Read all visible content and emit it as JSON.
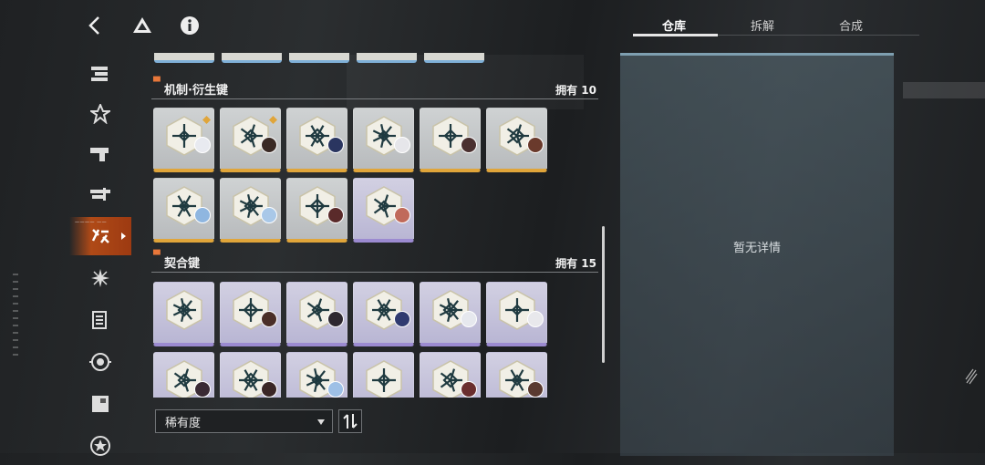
{
  "toolbar": {
    "back_icon": "chevron-left-icon",
    "drive_icon": "triangle-logo-icon",
    "info_icon": "info-icon"
  },
  "sidebar": {
    "items": [
      {
        "icon": "stack-bars-icon",
        "active": false
      },
      {
        "icon": "star-triangle-icon",
        "active": false
      },
      {
        "icon": "gun-icon",
        "active": false
      },
      {
        "icon": "rifle-icon",
        "active": false
      },
      {
        "icon": "keys-icon",
        "active": true,
        "tag": "———— ——"
      },
      {
        "icon": "burst-icon",
        "active": false
      },
      {
        "icon": "document-icon",
        "active": false
      },
      {
        "icon": "target-icon",
        "active": false
      },
      {
        "icon": "box-icon",
        "active": false
      },
      {
        "icon": "star-circle-icon",
        "active": false
      }
    ]
  },
  "sections": [
    {
      "title": "机制·衍生键",
      "count_label": "拥有 10",
      "cards": [
        {
          "rarity": "gold",
          "emblem": "star-lattice-icon",
          "avatar": "#e8eaf0",
          "corner": true
        },
        {
          "rarity": "gold",
          "emblem": "diamond-spire-icon",
          "avatar": "#3a2a25",
          "corner": true
        },
        {
          "rarity": "gold",
          "emblem": "cross-lattice-icon",
          "avatar": "#2a3560",
          "corner": false
        },
        {
          "rarity": "gold",
          "emblem": "twin-arch-icon",
          "avatar": "#e6e6ea",
          "corner": false
        },
        {
          "rarity": "gold",
          "emblem": "snow-burst-icon",
          "avatar": "#4a3030",
          "corner": false
        },
        {
          "rarity": "gold",
          "emblem": "petal-cross-icon",
          "avatar": "#6a3a2c",
          "corner": false
        },
        {
          "rarity": "gold",
          "emblem": "gate-pattern-icon",
          "avatar": "#8fb6e0",
          "corner": false
        },
        {
          "rarity": "gold",
          "emblem": "orbit-ring-icon",
          "avatar": "#a9c8e8",
          "corner": false
        },
        {
          "rarity": "gold",
          "emblem": "diamond-chain-icon",
          "avatar": "#5a2a2a",
          "corner": false
        },
        {
          "rarity": "purple",
          "emblem": "knot-loop-icon",
          "avatar": "#c06a5a",
          "corner": false
        }
      ]
    },
    {
      "title": "契合键",
      "count_label": "拥有 15",
      "cards": [
        {
          "rarity": "purple",
          "emblem": "triangle-seal-icon",
          "avatar": "",
          "corner": false
        },
        {
          "rarity": "purple",
          "emblem": "compass-star-icon",
          "avatar": "#4a2e28",
          "corner": false
        },
        {
          "rarity": "purple",
          "emblem": "square-knot-icon",
          "avatar": "#2e2830",
          "corner": false
        },
        {
          "rarity": "purple",
          "emblem": "hex-ring-icon",
          "avatar": "#2f3a70",
          "corner": false
        },
        {
          "rarity": "purple",
          "emblem": "triple-star-icon",
          "avatar": "#e6e8ee",
          "corner": false
        },
        {
          "rarity": "purple",
          "emblem": "arrow-cross-icon",
          "avatar": "#e8e8ec",
          "corner": false
        },
        {
          "rarity": "purple",
          "emblem": "spike-star-icon",
          "avatar": "#3a2a34",
          "corner": false
        },
        {
          "rarity": "purple",
          "emblem": "flower-star-icon",
          "avatar": "#3a2626",
          "corner": false
        },
        {
          "rarity": "purple",
          "emblem": "rune-cluster-icon",
          "avatar": "#9ec0e6",
          "corner": false
        },
        {
          "rarity": "purple",
          "emblem": "cross-flower-icon",
          "avatar": "",
          "corner": false
        },
        {
          "rarity": "purple",
          "emblem": "eye-ring-icon",
          "avatar": "#6a2e2e",
          "corner": false
        },
        {
          "rarity": "purple",
          "emblem": "diamond-flower-icon",
          "avatar": "#5a3a30",
          "corner": false
        }
      ]
    }
  ],
  "sort": {
    "selected": "稀有度",
    "dropdown_icon": "caret-down-icon",
    "order_icon": "sort-order-icon"
  },
  "tabs": [
    {
      "label": "仓库",
      "active": true
    },
    {
      "label": "拆解",
      "active": false
    },
    {
      "label": "合成",
      "active": false
    }
  ],
  "detail": {
    "empty_text": "暂无详情"
  },
  "colors": {
    "accent": "#e8773a",
    "gold_rarity": "#e0a53a",
    "purple_rarity": "#9b8ad0",
    "detail_top": "#7e9fb0"
  }
}
